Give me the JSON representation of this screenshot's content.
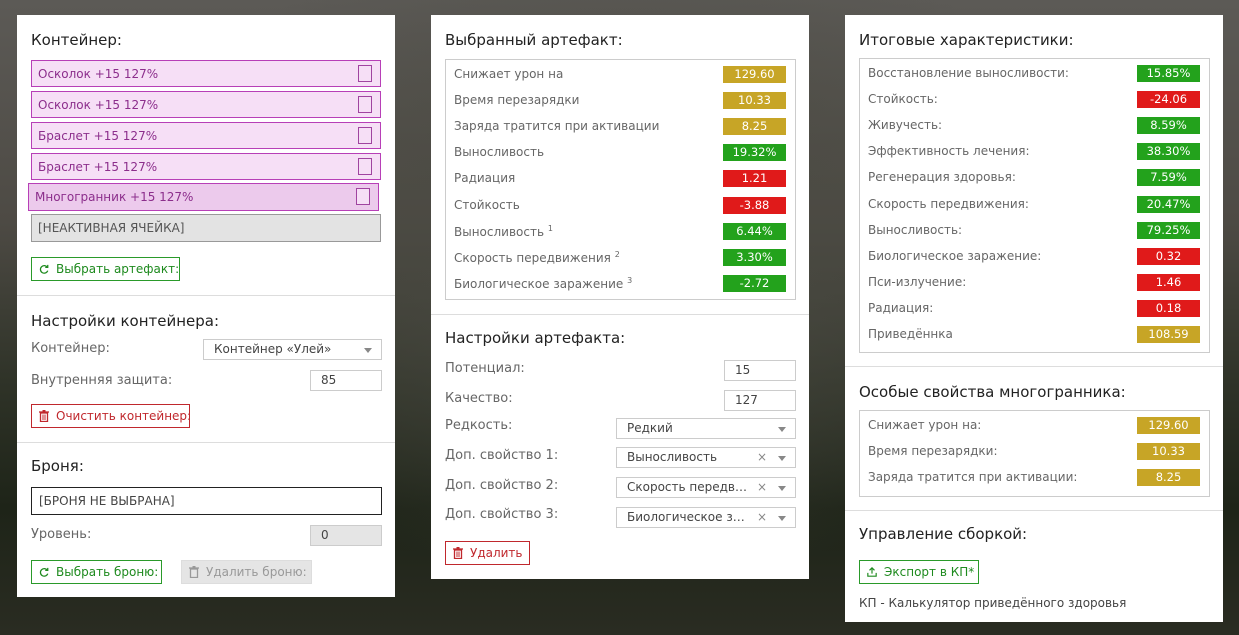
{
  "colors": {
    "yellow": "#c7a526",
    "green": "#23a21c",
    "red": "#e01a1a",
    "accent_purple": "#b73fb7"
  },
  "container": {
    "title": "Контейнер:",
    "slots": [
      {
        "label": "Осколок +15 127%"
      },
      {
        "label": "Осколок +15 127%"
      },
      {
        "label": "Браслет +15 127%"
      },
      {
        "label": "Браслет +15 127%"
      },
      {
        "label": "Многогранник +15 127%"
      }
    ],
    "inactive_label": "[НЕАКТИВНАЯ ЯЧЕЙКА]",
    "choose_button": "Выбрать артефакт:"
  },
  "container_settings": {
    "title": "Настройки контейнера:",
    "container_label": "Контейнер:",
    "container_value": "Контейнер «Улей»",
    "protection_label": "Внутренняя защита:",
    "protection_value": "85",
    "clear_button": "Очистить контейнер:"
  },
  "armor": {
    "title": "Броня:",
    "value": "[БРОНЯ НЕ ВЫБРАНА]",
    "level_label": "Уровень:",
    "level_value": "0",
    "choose_button": "Выбрать броню:",
    "remove_button": "Удалить броню:"
  },
  "selected_artifact": {
    "title": "Выбранный артефакт:",
    "stats": [
      {
        "label": "Снижает урон на",
        "value": "129.60",
        "color": "y"
      },
      {
        "label": "Время перезарядки",
        "value": "10.33",
        "color": "y"
      },
      {
        "label": "Заряда тратится при активации",
        "value": "8.25",
        "color": "y"
      },
      {
        "label": "Выносливость",
        "value": "19.32%",
        "color": "g"
      },
      {
        "label": "Радиация",
        "value": "1.21",
        "color": "r"
      },
      {
        "label": "Стойкость",
        "value": "-3.88",
        "color": "r"
      },
      {
        "label": "Выносливость",
        "sup": "1",
        "value": "6.44%",
        "color": "g"
      },
      {
        "label": "Скорость передвижения",
        "sup": "2",
        "value": "3.30%",
        "color": "g"
      },
      {
        "label": "Биологическое заражение",
        "sup": "3",
        "value": "-2.72",
        "color": "g"
      }
    ]
  },
  "artifact_settings": {
    "title": "Настройки артефакта:",
    "potential_label": "Потенциал:",
    "potential_value": "15",
    "quality_label": "Качество:",
    "quality_value": "127",
    "rarity_label": "Редкость:",
    "rarity_value": "Редкий",
    "prop1_label": "Доп. свойство 1:",
    "prop1_value": "Выносливость",
    "prop2_label": "Доп. свойство 2:",
    "prop2_value": "Скорость передвижения",
    "prop3_label": "Доп. свойство 3:",
    "prop3_value": "Биологическое заражение",
    "delete_button": "Удалить"
  },
  "totals": {
    "title": "Итоговые характеристики:",
    "stats": [
      {
        "label": "Восстановление выносливости:",
        "value": "15.85%",
        "color": "g"
      },
      {
        "label": "Стойкость:",
        "value": "-24.06",
        "color": "r"
      },
      {
        "label": "Живучесть:",
        "value": "8.59%",
        "color": "g"
      },
      {
        "label": "Эффективность лечения:",
        "value": "38.30%",
        "color": "g"
      },
      {
        "label": "Регенерация здоровья:",
        "value": "7.59%",
        "color": "g"
      },
      {
        "label": "Скорость передвижения:",
        "value": "20.47%",
        "color": "g"
      },
      {
        "label": "Выносливость:",
        "value": "79.25%",
        "color": "g"
      },
      {
        "label": "Биологическое заражение:",
        "value": "0.32",
        "color": "r"
      },
      {
        "label": "Пси-излучение:",
        "value": "1.46",
        "color": "r"
      },
      {
        "label": "Радиация:",
        "value": "0.18",
        "color": "r"
      },
      {
        "label": "Приведённка",
        "value": "108.59",
        "color": "y"
      }
    ]
  },
  "polyhedron": {
    "title": "Особые свойства многогранника:",
    "stats": [
      {
        "label": "Снижает урон на:",
        "value": "129.60",
        "color": "y"
      },
      {
        "label": "Время перезарядки:",
        "value": "10.33",
        "color": "y"
      },
      {
        "label": "Заряда тратится при активации:",
        "value": "8.25",
        "color": "y"
      }
    ]
  },
  "build": {
    "title": "Управление сборкой:",
    "export_button": "Экспорт в КП*",
    "footnote": "КП - Калькулятор приведённого здоровья"
  }
}
